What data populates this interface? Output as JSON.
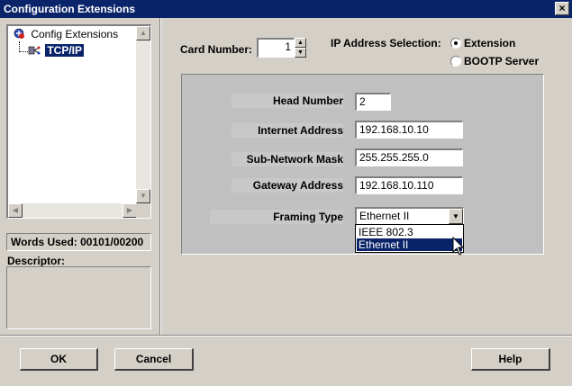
{
  "window": {
    "title": "Configuration Extensions",
    "close_glyph": "×"
  },
  "tree": {
    "root_label": "Config Extensions",
    "child_label": "TCP/IP",
    "selected_color": "#0a246a"
  },
  "words_used": "Words Used: 00101/00200",
  "descriptor_label": "Descriptor:",
  "card_number": {
    "label": "Card Number:",
    "value": "1"
  },
  "ip_selection": {
    "label": "IP Address Selection:",
    "options": [
      {
        "label": "Extension",
        "selected": true
      },
      {
        "label": "BOOTP Server",
        "selected": false
      }
    ]
  },
  "fields": {
    "head_number": {
      "label": "Head Number",
      "value": "2"
    },
    "internet_address": {
      "label": "Internet Address",
      "value": "192.168.10.10"
    },
    "subnet_mask": {
      "label": "Sub-Network Mask",
      "value": "255.255.255.0"
    },
    "gateway_address": {
      "label": "Gateway Address",
      "value": "192.168.10.110"
    }
  },
  "framing_type": {
    "label": "Framing Type",
    "value": "Ethernet II",
    "options": [
      "IEEE 802.3",
      "Ethernet II"
    ],
    "highlighted_index": 1
  },
  "buttons": {
    "ok": "OK",
    "cancel": "Cancel",
    "help": "Help"
  }
}
